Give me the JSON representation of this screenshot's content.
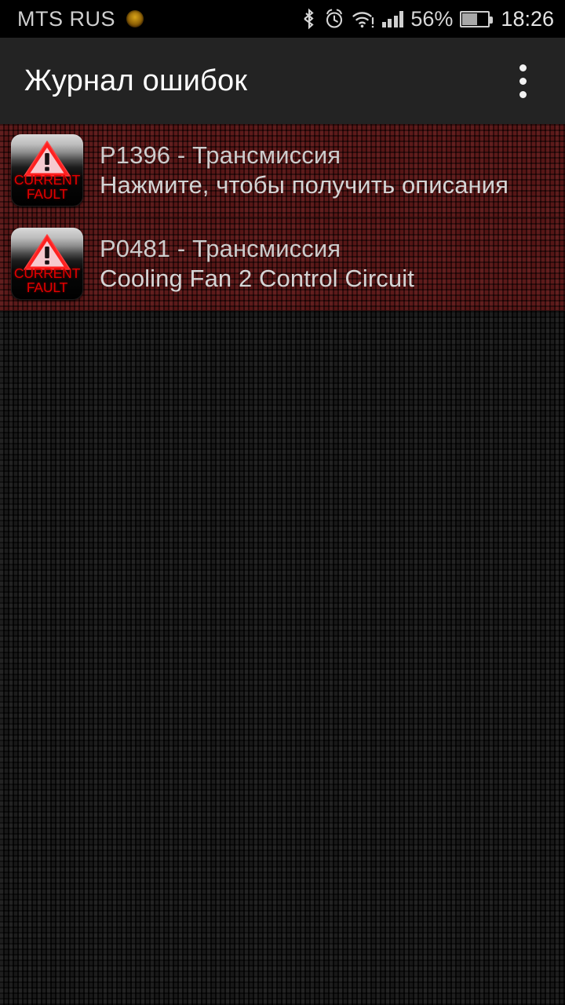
{
  "statusbar": {
    "carrier": "MTS RUS",
    "carrier_badge_icon": "app-badge-icon",
    "bluetooth_icon": "bluetooth-icon",
    "alarm_icon": "alarm-clock-icon",
    "wifi_icon": "wifi-warning-icon",
    "signal_icon": "signal-bars-icon",
    "battery_percent": "56%",
    "battery_icon": "battery-icon",
    "clock": "18:26",
    "colors": {
      "background": "#000000",
      "text": "#cfcfcf"
    }
  },
  "actionbar": {
    "title": "Журнал ошибок",
    "overflow_icon": "overflow-menu-icon",
    "colors": {
      "background": "#232323",
      "title": "#ffffff"
    }
  },
  "main": {
    "faults": [
      {
        "badge": {
          "icon": "warning-triangle-icon",
          "line1": "CURRENT",
          "line2": "FAULT"
        },
        "code": "P1396 - Трансмиссия",
        "description": "Нажмите, чтобы получить описания"
      },
      {
        "badge": {
          "icon": "warning-triangle-icon",
          "line1": "CURRENT",
          "line2": "FAULT"
        },
        "code": "P0481 - Трансмиссия",
        "description": "Cooling Fan 2 Control Circuit"
      }
    ],
    "colors": {
      "row_background": "#4a0d0d",
      "page_background": "#0b0b0b",
      "code_text": "#cccccc",
      "description_text": "#d4d4d4",
      "badge_label": "#e20000"
    }
  }
}
